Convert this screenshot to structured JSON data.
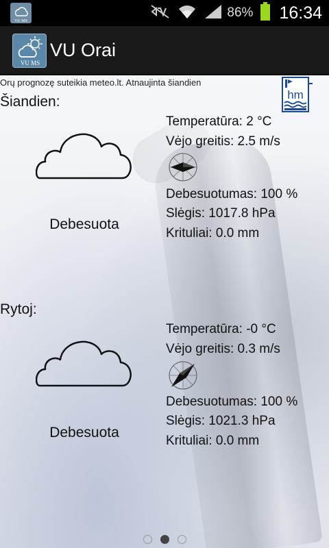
{
  "status_bar": {
    "app_icon": "vu-ms-notification-icon",
    "icons": [
      "mute-icon",
      "wifi-icon",
      "signal-icon"
    ],
    "battery_percent": "86%",
    "time": "16:34"
  },
  "action_bar": {
    "title": "VU Orai",
    "logo_text": "VU MS"
  },
  "source_text": "Orų prognozę suteikia meteo.lt. Atnaujinta šiandien",
  "today": {
    "title": "Šiandien:",
    "condition": "Debesuota",
    "temperature": "Temperatūra: 2 °C",
    "wind": "Vėjo greitis: 2.5 m/s",
    "cloudiness": "Debesuotumas: 100 %",
    "pressure": "Slėgis: 1017.8 hPa",
    "precipitation": "Krituliai: 0.0 mm"
  },
  "tomorrow": {
    "title": "Rytoj:",
    "condition": "Debesuota",
    "temperature": "Temperatūra: -0 °C",
    "wind": "Vėjo greitis: 0.3 m/s",
    "cloudiness": "Debesuotumas: 100 %",
    "pressure": "Slėgis: 1021.3 hPa",
    "precipitation": "Krituliai: 0.0 mm"
  },
  "pager": {
    "pages": 3,
    "active_index": 1
  }
}
